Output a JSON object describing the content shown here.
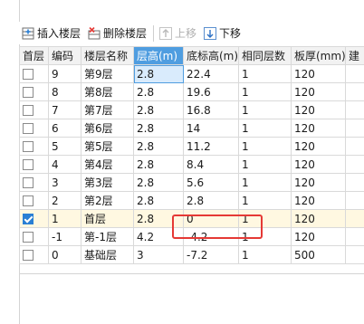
{
  "toolbar": {
    "insert_floor": "插入楼层",
    "delete_floor": "删除楼层",
    "move_up": "上移",
    "move_down": "下移"
  },
  "columns": [
    "首层",
    "编码",
    "楼层名称",
    "层高(m)",
    "底标高(m)",
    "相同层数",
    "板厚(mm)",
    "建"
  ],
  "highlighted_column": "层高(m)",
  "rows": [
    {
      "first": false,
      "code": "9",
      "name": "第9层",
      "height": "2.8",
      "elevation": "22.4",
      "same": "1",
      "thickness": "120"
    },
    {
      "first": false,
      "code": "8",
      "name": "第8层",
      "height": "2.8",
      "elevation": "19.6",
      "same": "1",
      "thickness": "120"
    },
    {
      "first": false,
      "code": "7",
      "name": "第7层",
      "height": "2.8",
      "elevation": "16.8",
      "same": "1",
      "thickness": "120"
    },
    {
      "first": false,
      "code": "6",
      "name": "第6层",
      "height": "2.8",
      "elevation": "14",
      "same": "1",
      "thickness": "120"
    },
    {
      "first": false,
      "code": "5",
      "name": "第5层",
      "height": "2.8",
      "elevation": "11.2",
      "same": "1",
      "thickness": "120"
    },
    {
      "first": false,
      "code": "4",
      "name": "第4层",
      "height": "2.8",
      "elevation": "8.4",
      "same": "1",
      "thickness": "120"
    },
    {
      "first": false,
      "code": "3",
      "name": "第3层",
      "height": "2.8",
      "elevation": "5.6",
      "same": "1",
      "thickness": "120"
    },
    {
      "first": false,
      "code": "2",
      "name": "第2层",
      "height": "2.8",
      "elevation": "2.8",
      "same": "1",
      "thickness": "120"
    },
    {
      "first": true,
      "code": "1",
      "name": "首层",
      "height": "2.8",
      "elevation": "0",
      "same": "1",
      "thickness": "120"
    },
    {
      "first": false,
      "code": "-1",
      "name": "第-1层",
      "height": "4.2",
      "elevation": "-4.2",
      "same": "1",
      "thickness": "120"
    },
    {
      "first": false,
      "code": "0",
      "name": "基础层",
      "height": "3",
      "elevation": "-7.2",
      "same": "1",
      "thickness": "500"
    }
  ],
  "colors": {
    "header_highlight": "#4f9de0",
    "checkbox_checked": "#2a7fd4",
    "selected_row": "#fff8e1",
    "annotation": "#e53935"
  }
}
